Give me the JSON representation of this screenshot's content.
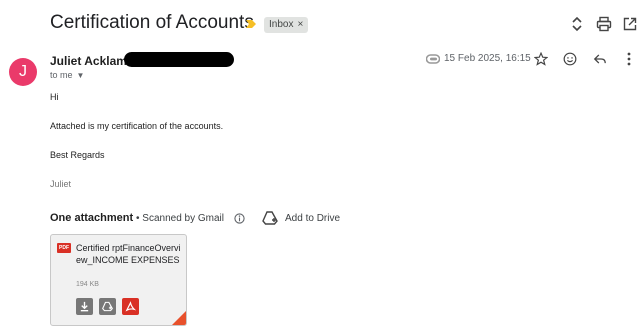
{
  "email": {
    "subject": "Certification of Accounts",
    "label": "Inbox",
    "label_close": "×",
    "sender_initial": "J",
    "sender_name": "Juliet Acklam",
    "recipient": "to me",
    "date": "15 Feb 2025, 16:15",
    "body": {
      "greeting": "Hi",
      "line1": "Attached is my certification of the accounts.",
      "closing": "Best Regards",
      "signature": "Juliet"
    }
  },
  "attachments": {
    "heading": "One attachment",
    "scanned_text": "• Scanned by Gmail",
    "add_to_drive": "Add to Drive",
    "file": {
      "type_badge": "PDF",
      "name": "Certified rptFinanceOverview_INCOME EXPENSES",
      "size": "194 KB"
    }
  },
  "colors": {
    "avatar": "#ea3a6a",
    "label_arrow": "#f6bf26",
    "pdf_red": "#d93025",
    "card_button_gray": "#777777"
  },
  "icons": {
    "toolbar": [
      "expand-collapse-icon",
      "print-icon",
      "open-new-window-icon"
    ],
    "actions": [
      "star-icon",
      "emoji-icon",
      "reply-icon",
      "more-vert-icon"
    ],
    "card": [
      "download-icon",
      "save-to-drive-icon",
      "pdf-open-icon"
    ]
  }
}
